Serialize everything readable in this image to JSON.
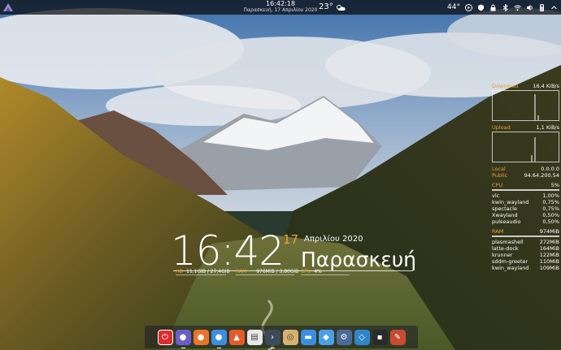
{
  "top_panel": {
    "time": "16:42:18",
    "date": "Παρασκευή, 17 Απριλίου 2020",
    "weather_temp": "23°",
    "cpu_temp": "44°",
    "launcher_icon": "kde-launcher-icon",
    "tray_icons": [
      "play-icon",
      "shield-icon",
      "vpn-lock-icon",
      "bluetooth-icon",
      "wifi-icon",
      "volume-icon",
      "battery-icon",
      "chevron-up-icon"
    ]
  },
  "clock_widget": {
    "time": "16:42",
    "day": "17",
    "month_year": "Απριλίου 2020",
    "weekday": "Παρασκευή",
    "disk_label": "HD",
    "disk_value": "11,1GiB / 27,4GiB",
    "ram_label": "RAM",
    "ram_value": "976MiB / 3,80GiB",
    "cpu_label": "CPU",
    "cpu_value": "4%"
  },
  "sysmon": {
    "download_label": "Download",
    "download_value": "16,4 KiB/s",
    "upload_label": "Upload",
    "upload_value": "1,1 KiB/s",
    "local_label": "Local",
    "local_value": "0.0.0.0",
    "public_label": "Public",
    "public_value": "94.64.200.54",
    "cpu_label": "CPU",
    "cpu_value": "5%",
    "cpu_procs": [
      {
        "name": "vlc",
        "value": "1,00%"
      },
      {
        "name": "kwin_wayland",
        "value": "0,75%"
      },
      {
        "name": "spectacle",
        "value": "0,75%"
      },
      {
        "name": "Xwayland",
        "value": "0,50%"
      },
      {
        "name": "pulseaudio",
        "value": "0,50%"
      }
    ],
    "ram_label": "RAM",
    "ram_value": "974MiB",
    "ram_procs": [
      {
        "name": "plasmashell",
        "value": "272MiB"
      },
      {
        "name": "latte-dock",
        "value": "164MiB"
      },
      {
        "name": "krunner",
        "value": "122MiB"
      },
      {
        "name": "sddm-greeter",
        "value": "110MiB"
      },
      {
        "name": "kwin_wayland",
        "value": "109MiB"
      }
    ]
  },
  "dock": {
    "apps": [
      {
        "name": "shutdown",
        "icon": "power-icon",
        "color": "#d92e2e",
        "glyph": "⏻"
      },
      {
        "name": "settings",
        "icon": "settings-icon",
        "color": "#6a5fc8",
        "glyph": "●"
      },
      {
        "name": "firefox",
        "icon": "firefox-icon",
        "color": "#e8732a",
        "glyph": "●"
      },
      {
        "name": "chrome",
        "icon": "chrome-icon",
        "color": "#3a8fe0",
        "glyph": "●"
      },
      {
        "name": "brave",
        "icon": "brave-icon",
        "color": "#e65a2a",
        "glyph": "▲"
      },
      {
        "name": "document-viewer",
        "icon": "document-icon",
        "color": "#e8e8e8",
        "glyph": "▤"
      },
      {
        "name": "terminal",
        "icon": "terminal-icon",
        "color": "#3c4a5a",
        "glyph": "›"
      },
      {
        "name": "disks",
        "icon": "disk-icon",
        "color": "#d8b070",
        "glyph": "◎"
      },
      {
        "name": "files",
        "icon": "folder-icon",
        "color": "#3d8ee0",
        "glyph": "▬"
      },
      {
        "name": "discover",
        "icon": "store-icon",
        "color": "#4aa0e8",
        "glyph": "◆"
      },
      {
        "name": "system-monitor",
        "icon": "monitor-icon",
        "color": "#4a6a9a",
        "glyph": "⚙"
      },
      {
        "name": "kdeconnect",
        "icon": "kdeconnect-icon",
        "color": "#2e86c8",
        "glyph": "◇"
      },
      {
        "name": "konsole",
        "icon": "console-icon",
        "color": "#2a2a2a",
        "glyph": "▪"
      },
      {
        "name": "kate",
        "icon": "editor-icon",
        "color": "#c84a30",
        "glyph": "✎"
      }
    ]
  },
  "colors": {
    "accent": "#f0a030"
  }
}
